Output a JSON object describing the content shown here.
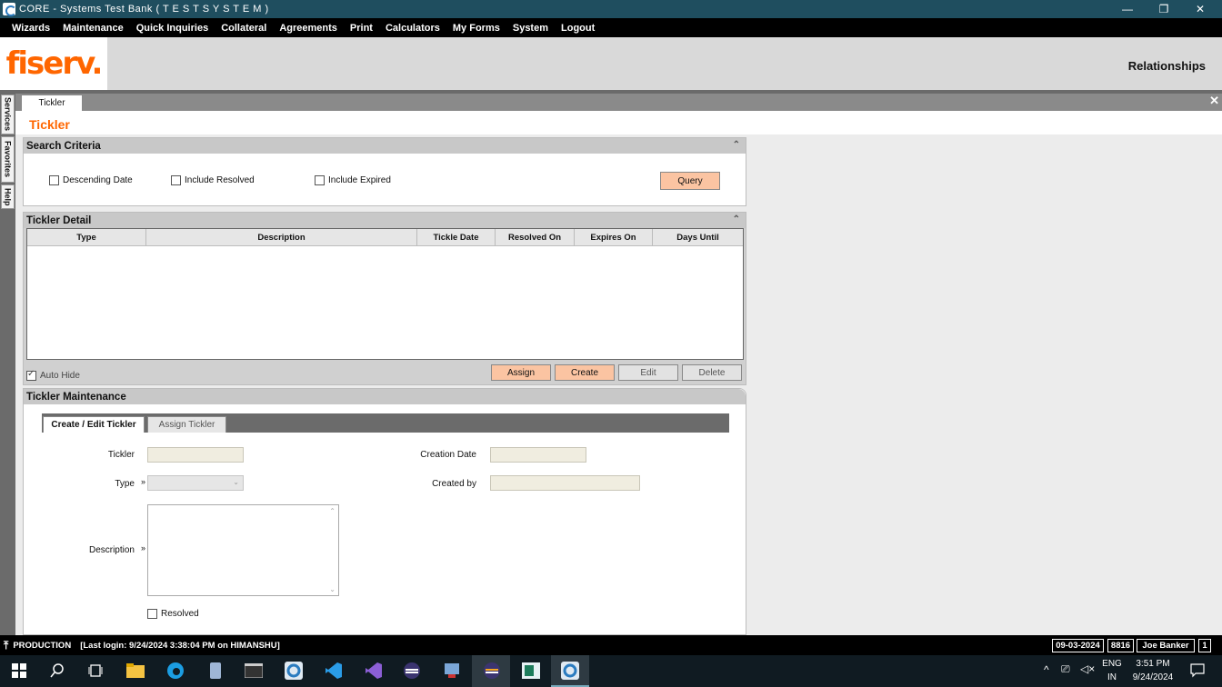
{
  "window": {
    "title": "CORE - Systems Test Bank ( T E S T   S Y S T E M )",
    "minimize": "—",
    "maximize": "❐",
    "close": "✕"
  },
  "menu": [
    "Wizards",
    "Maintenance",
    "Quick Inquiries",
    "Collateral",
    "Agreements",
    "Print",
    "Calculators",
    "My Forms",
    "System",
    "Logout"
  ],
  "header": {
    "logo": "fiserv.",
    "section_title": "Relationships"
  },
  "sidebar": {
    "tabs": [
      "Services",
      "Favorites",
      "Help"
    ]
  },
  "tab": {
    "label": "Tickler",
    "close": "✕"
  },
  "page_title": "Tickler",
  "search": {
    "title": "Search Criteria",
    "collapse": "⌃",
    "descending_date": "Descending Date",
    "include_resolved": "Include Resolved",
    "include_expired": "Include Expired",
    "query_label": "Query"
  },
  "detail": {
    "title": "Tickler Detail",
    "collapse": "⌃",
    "columns": [
      "Type",
      "Description",
      "Tickle Date",
      "Resolved On",
      "Expires On",
      "Days Until"
    ],
    "auto_hide": "Auto Hide",
    "assign_label": "Assign",
    "create_label": "Create",
    "edit_label": "Edit",
    "delete_label": "Delete"
  },
  "maintenance": {
    "title": "Tickler Maintenance",
    "tabs": [
      "Create / Edit Tickler",
      "Assign Tickler"
    ],
    "tickler_label": "Tickler",
    "type_label": "Type",
    "description_label": "Description",
    "creation_date_label": "Creation Date",
    "created_by_label": "Created by",
    "resolved_label": "Resolved",
    "chevron": "»"
  },
  "status": {
    "env": "PRODUCTION",
    "last_login": "[Last login: 9/24/2024 3:38:04 PM on HIMANSHU]",
    "date": "09-03-2024",
    "branch": "8816",
    "user": "Joe Banker",
    "count": "1"
  },
  "taskbar": {
    "lang": "ENG",
    "region": "IN",
    "time": "3:51 PM",
    "date": "9/24/2024"
  }
}
